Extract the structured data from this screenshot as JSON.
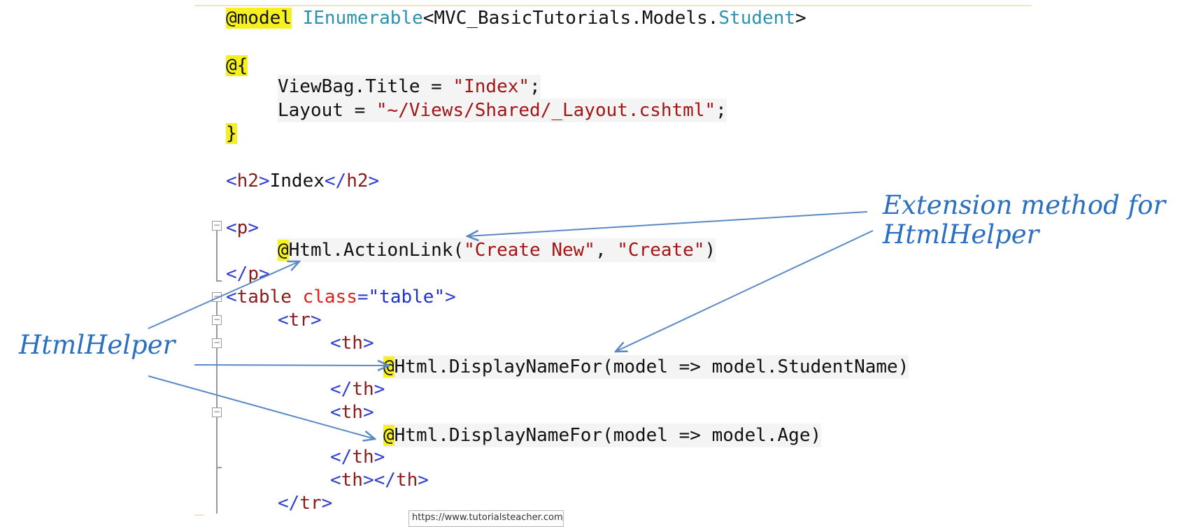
{
  "code": {
    "l1": {
      "kw": "@model",
      "type1": "IEnumerable",
      "mid": "<MVC_BasicTutorials.Models.",
      "type2": "Student",
      "end": ">"
    },
    "l2": {
      "at": "@{"
    },
    "l3": {
      "a": "ViewBag.Title = ",
      "s": "\"Index\"",
      "e": ";"
    },
    "l4": {
      "a": "Layout = ",
      "s": "\"~/Views/Shared/_Layout.cshtml\"",
      "e": ";"
    },
    "l5": {
      "b": "}"
    },
    "l6": {
      "o": "<",
      "t1": "h2",
      "c": ">",
      "txt": "Index",
      "o2": "</",
      "t2": "h2",
      "c2": ">"
    },
    "l7": {
      "o": "<",
      "t": "p",
      "c": ">"
    },
    "l8": {
      "at": "@",
      "call": "Html.ActionLink(",
      "s1": "\"Create New\"",
      "comma": ", ",
      "s2": "\"Create\"",
      "end": ")"
    },
    "l9": {
      "o": "</",
      "t": "p",
      "c": ">"
    },
    "l10": {
      "o": "<",
      "t": "table",
      "sp": " ",
      "attr": "class",
      "eq": "=",
      "val": "\"table\"",
      "c": ">"
    },
    "l11": {
      "o": "<",
      "t": "tr",
      "c": ">"
    },
    "l12": {
      "o": "<",
      "t": "th",
      "c": ">"
    },
    "l13": {
      "at": "@",
      "rest": "Html.DisplayNameFor(model => model.StudentName)"
    },
    "l14": {
      "o": "</",
      "t": "th",
      "c": ">"
    },
    "l15": {
      "o": "<",
      "t": "th",
      "c": ">"
    },
    "l16": {
      "at": "@",
      "rest": "Html.DisplayNameFor(model => model.Age)"
    },
    "l17": {
      "o": "</",
      "t": "th",
      "c": ">"
    },
    "l18": {
      "o": "<",
      "t": "th",
      "c": "></",
      "t2": "th",
      "c2": ">"
    },
    "l19": {
      "o": "</",
      "t": "tr",
      "c": ">"
    }
  },
  "annotations": {
    "extension_line1": "Extension method for",
    "extension_line2": "HtmlHelper",
    "htmlhelper": "HtmlHelper"
  },
  "tooltip": {
    "url": "https://www.tutorialsteacher.com/mvc/"
  },
  "colors": {
    "annotation": "#2b6fc0",
    "highlight": "#f6f11e",
    "keyword": "#1f5bd8",
    "string": "#a31515",
    "tag_name": "#8b1a1a"
  }
}
